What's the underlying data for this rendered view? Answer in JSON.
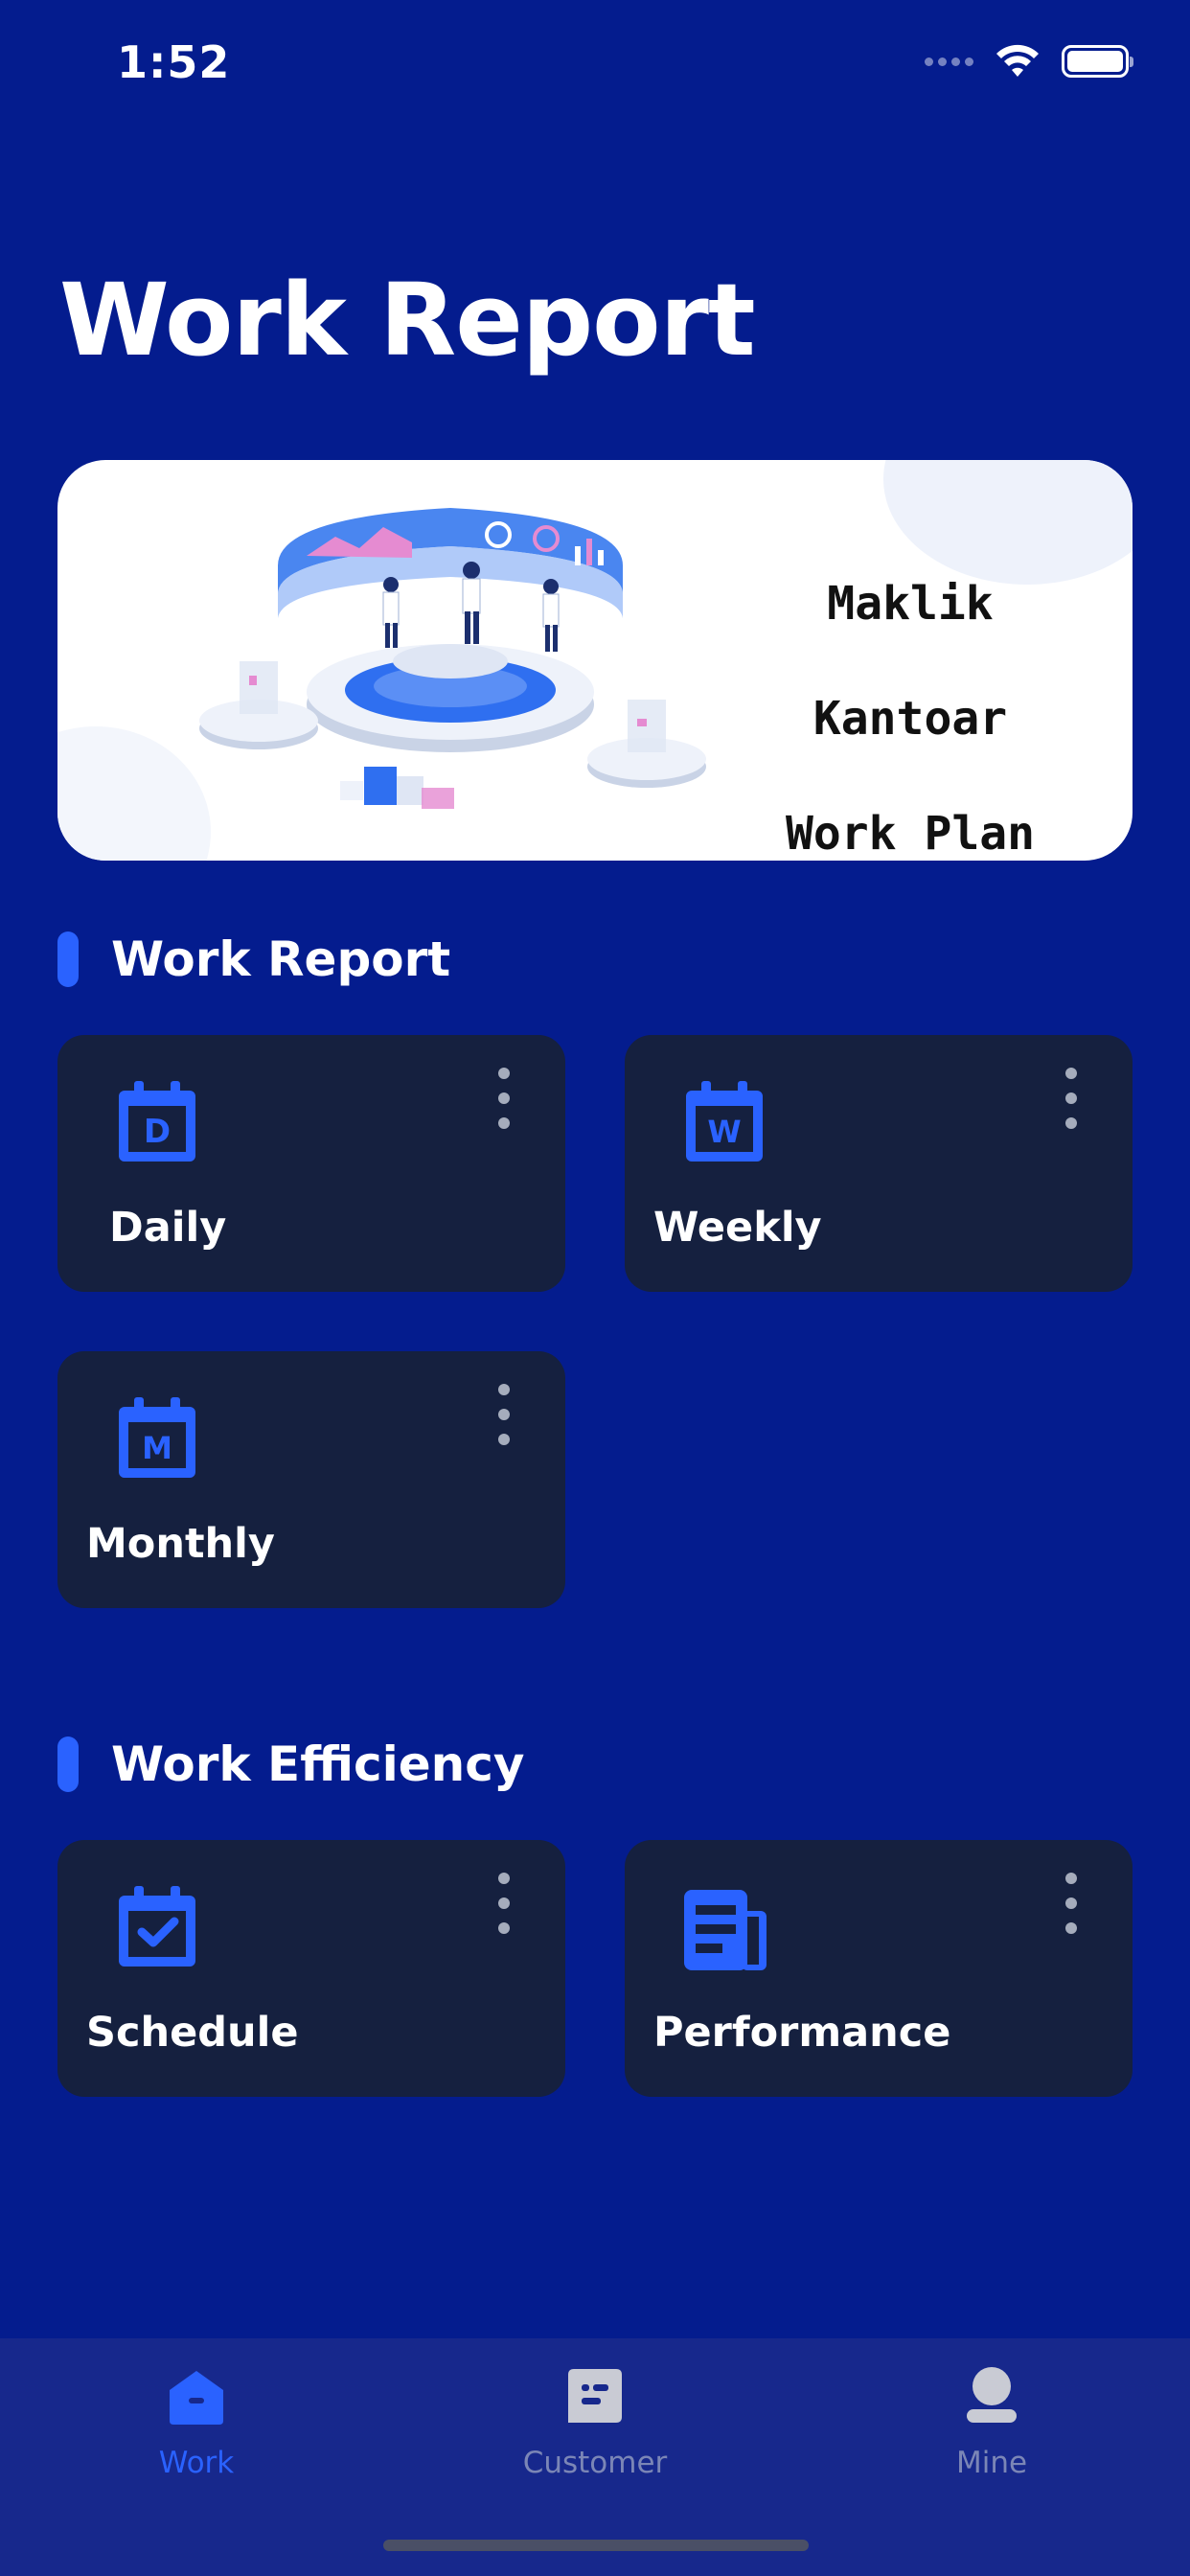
{
  "status_bar": {
    "time": "1:52"
  },
  "page": {
    "title": "Work Report"
  },
  "banner": {
    "line1": "Maklik Kantoar",
    "line2": "Work Plan"
  },
  "sections": {
    "report": {
      "title": "Work Report",
      "cards": [
        {
          "label": "Daily",
          "icon": "calendar-d-icon"
        },
        {
          "label": "Weekly",
          "icon": "calendar-w-icon"
        },
        {
          "label": "Monthly",
          "icon": "calendar-m-icon"
        }
      ]
    },
    "efficiency": {
      "title": "Work Efficiency",
      "cards": [
        {
          "label": "Schedule",
          "icon": "calendar-check-icon"
        },
        {
          "label": "Performance",
          "icon": "newspaper-icon"
        }
      ]
    }
  },
  "tabs": [
    {
      "label": "Work",
      "icon": "home-icon",
      "active": true
    },
    {
      "label": "Customer",
      "icon": "chat-icon",
      "active": false
    },
    {
      "label": "Mine",
      "icon": "user-icon",
      "active": false
    }
  ],
  "colors": {
    "background": "#041c8e",
    "card": "#15203f",
    "accent": "#2a62ff",
    "tab_bar": "#17288c",
    "tab_inactive": "#7b86b6"
  }
}
